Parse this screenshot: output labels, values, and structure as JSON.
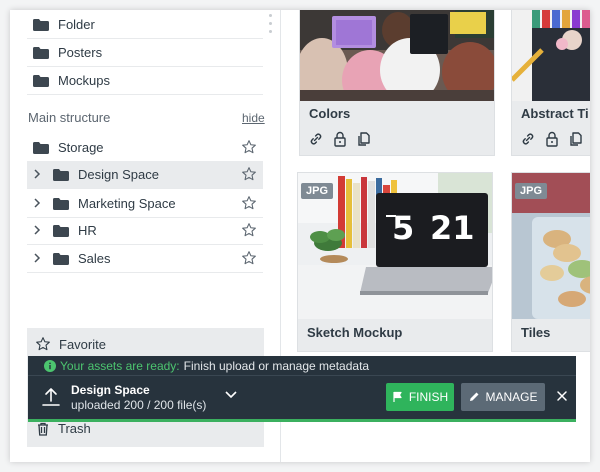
{
  "sidebar": {
    "top_folders": [
      {
        "label": "Folder"
      },
      {
        "label": "Posters"
      },
      {
        "label": "Mockups"
      }
    ],
    "section_title": "Main structure",
    "hide_label": "hide",
    "structure": [
      {
        "label": "Storage",
        "expandable": false,
        "selected": false
      },
      {
        "label": "Design Space",
        "expandable": true,
        "selected": true
      },
      {
        "label": "Marketing Space",
        "expandable": true,
        "selected": false
      },
      {
        "label": "HR",
        "expandable": true,
        "selected": false
      },
      {
        "label": "Sales",
        "expandable": true,
        "selected": false
      }
    ],
    "favorite_label": "Favorite",
    "trash_label": "Trash"
  },
  "cards": [
    {
      "title": "Colors",
      "badge": ""
    },
    {
      "title": "Abstract Ti",
      "badge": ""
    },
    {
      "title": "Sketch Mockup",
      "badge": "JPG"
    },
    {
      "title": "Tiles",
      "badge": "JPG"
    }
  ],
  "upload": {
    "ready_text": "Your assets are ready:",
    "status_rest": "Finish upload or manage metadata",
    "space_name": "Design Space",
    "progress_text": "uploaded 200 / 200 file(s)",
    "progress_fraction": 1.0,
    "finish_label": "FINISH",
    "manage_label": "MANAGE"
  },
  "colors": {
    "accent_green": "#2fb45c",
    "upload_bg": "#27333d",
    "ready_green": "#4cc56f"
  }
}
